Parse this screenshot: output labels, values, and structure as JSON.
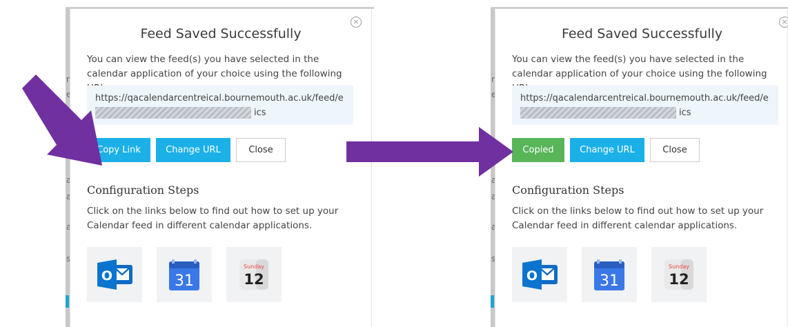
{
  "left_panel": {
    "title": "Feed Saved Successfully",
    "close_glyph": "×",
    "description": "You can view the feed(s) you have selected in the calendar application of your choice using the following URL:",
    "url_line1": "https://qacalendarcentreical.bournemouth.ac.uk/feed/e",
    "url_line2_suffix": "ics",
    "buttons": {
      "copy": "Copy Link",
      "change": "Change URL",
      "close": "Close"
    },
    "section_title": "Configuration Steps",
    "steps_text": "Click on the links below to find out how to set up your Calendar feed in different calendar applications.",
    "icons": {
      "outlook": "O",
      "google_day": "31",
      "apple_weekday": "Sunday",
      "apple_day": "12"
    }
  },
  "right_panel": {
    "title": "Feed Saved Successfully",
    "close_glyph": "×",
    "description": "You can view the feed(s) you have selected in the calendar application of your choice using the following URL:",
    "url_line1": "https://qacalendarcentreical.bournemouth.ac.uk/feed/e",
    "url_line2_suffix": "ics",
    "buttons": {
      "copy": "Copied",
      "change": "Change URL",
      "close": "Close"
    },
    "section_title": "Configuration Steps",
    "steps_text": "Click on the links below to find out how to set up your Calendar feed in different calendar applications.",
    "icons": {
      "outlook": "O",
      "google_day": "31",
      "apple_weekday": "Sunday",
      "apple_day": "12"
    }
  },
  "peek_letters": {
    "l_a": "n",
    "l_b": "e",
    "l_c": "a",
    "l_d": "a",
    "l_e": "a",
    "l_f": "s",
    "r_a": "n",
    "r_b": "e",
    "r_c": "a",
    "r_d": "a",
    "r_e": "a",
    "r_f": "s"
  },
  "colors": {
    "arrow": "#7030a0",
    "button_blue": "#1bb0e8",
    "button_green": "#58b558",
    "url_box": "#eef5fb"
  }
}
